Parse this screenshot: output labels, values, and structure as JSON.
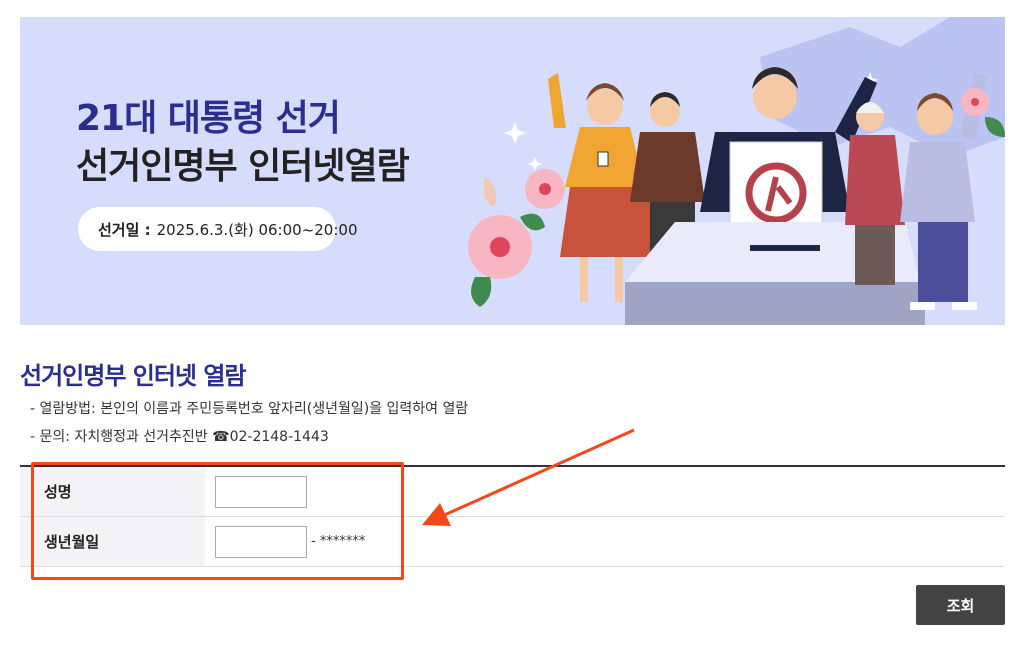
{
  "banner": {
    "title_line1": "21대 대통령 선거",
    "title_line2": "선거인명부 인터넷열람",
    "election_day_label": "선거일 :",
    "election_day_value": "2025.6.3.(화) 06:00~20:00",
    "background_color": "#d6dcfb",
    "accent_color": "#2a2f8f"
  },
  "section": {
    "title": "선거인명부 인터넷 열람",
    "info": [
      "열람방법: 본인의 이름과 주민등록번호 앞자리(생년월일)을 입력하여 열람",
      "문의: 자치행정과 선거추진반 ☎02-2148-1443"
    ]
  },
  "form": {
    "name_label": "성명",
    "name_value": "",
    "birth_label": "생년월일",
    "birth_value": "",
    "birth_suffix": "- *******"
  },
  "actions": {
    "search_label": "조회"
  },
  "annotation": {
    "color": "#f2481c"
  }
}
